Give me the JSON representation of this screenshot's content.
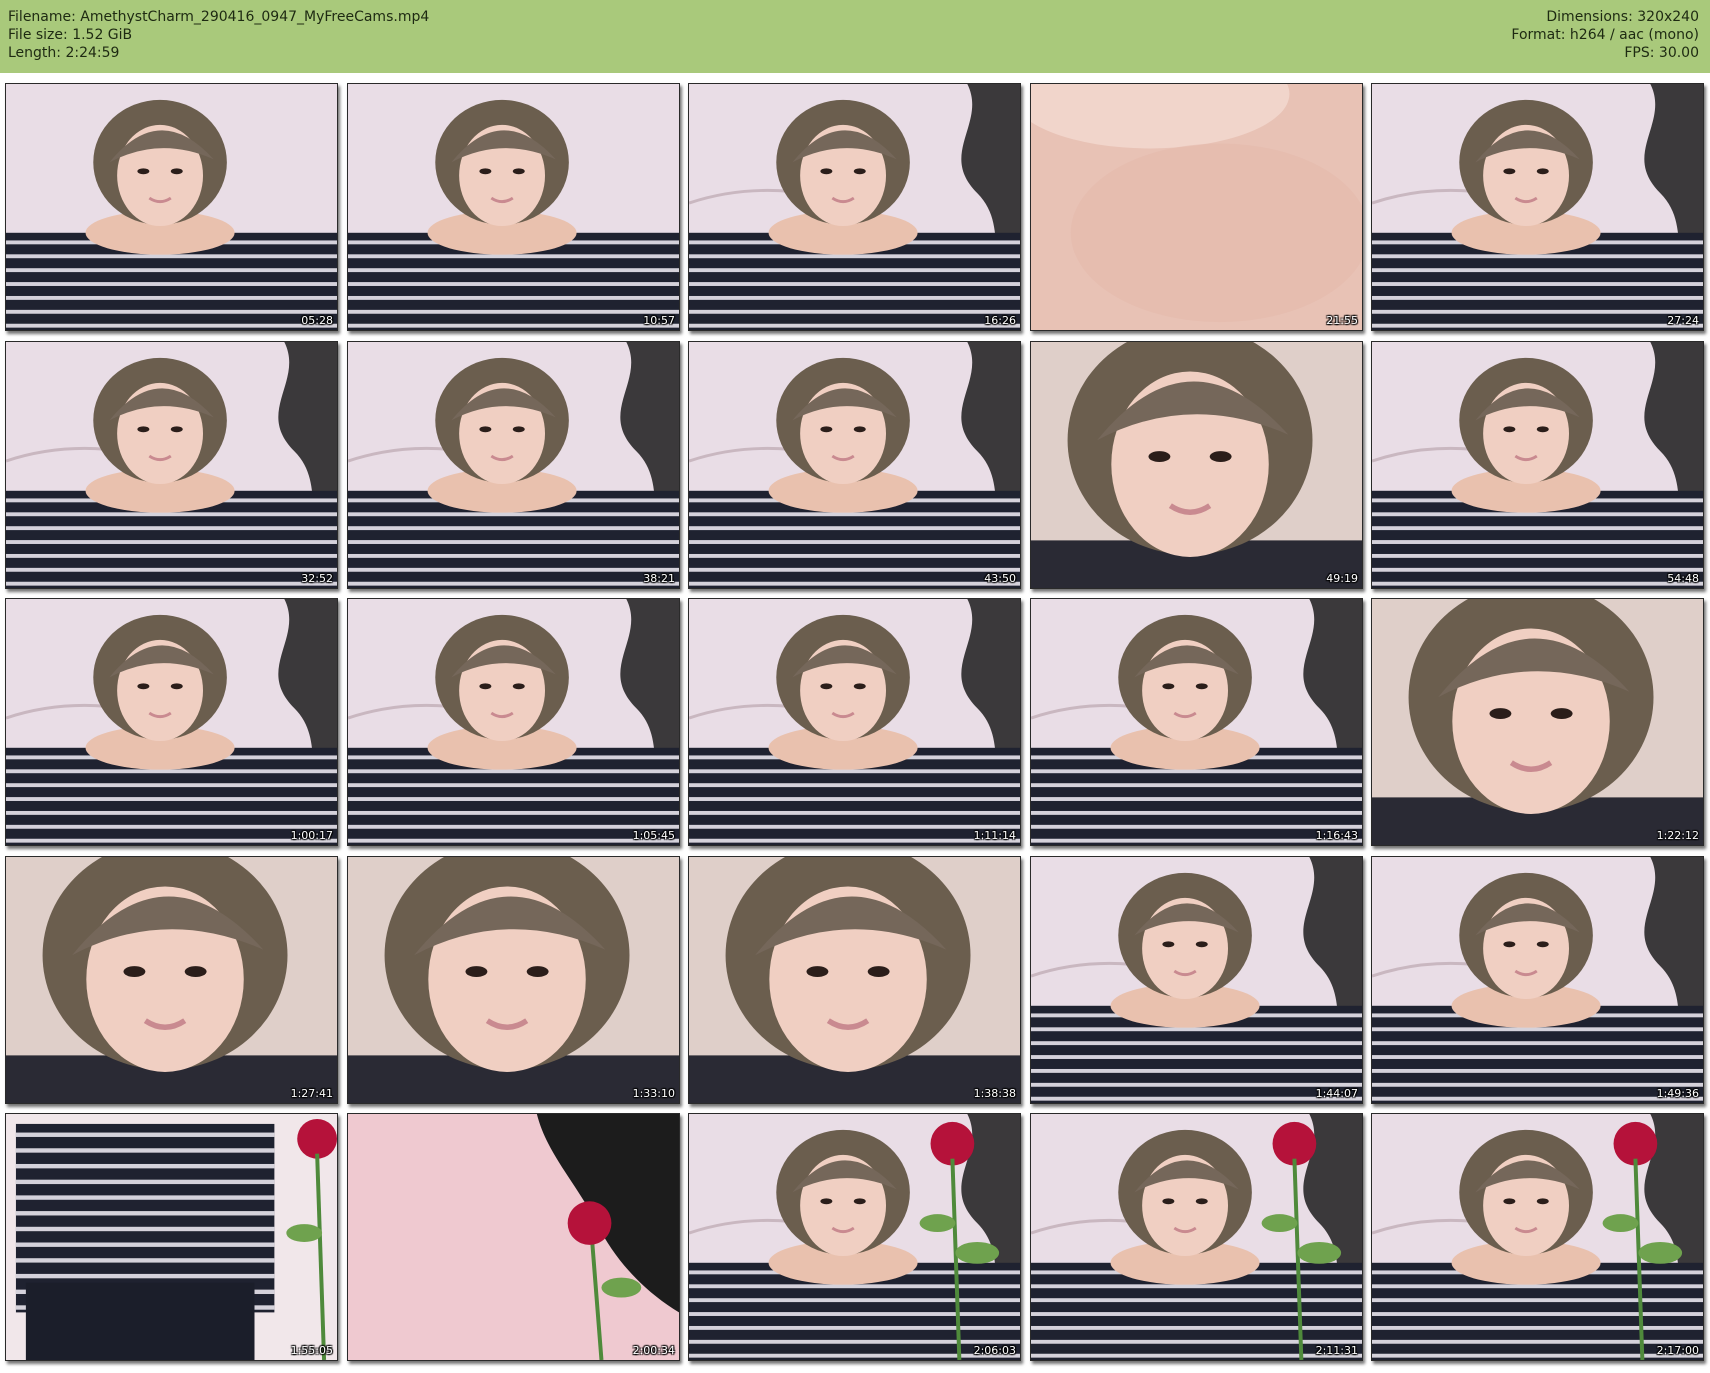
{
  "header": {
    "filename_label": "Filename: AmethystCharm_290416_0947_MyFreeCams.mp4",
    "filesize_label": "File size: 1.52 GiB",
    "length_label": "Length: 2:24:59",
    "dimensions_label": "Dimensions: 320x240",
    "format_label": "Format: h264 / aac (mono)",
    "fps_label": "FPS: 30.00"
  },
  "colors": {
    "header_background": "#a9c97b",
    "page_background": "#ffffff",
    "timecode_text": "#ffffff"
  },
  "thumbnails": [
    {
      "timecode": "05:28",
      "scene": "face-striped-shirt"
    },
    {
      "timecode": "10:57",
      "scene": "face-striped-shirt"
    },
    {
      "timecode": "16:26",
      "scene": "face-striped-shirt-wall"
    },
    {
      "timecode": "21:55",
      "scene": "skin-closeup"
    },
    {
      "timecode": "27:24",
      "scene": "face-striped-shirt-wall"
    },
    {
      "timecode": "32:52",
      "scene": "face-striped-shirt-wall"
    },
    {
      "timecode": "38:21",
      "scene": "face-striped-shirt-wall"
    },
    {
      "timecode": "43:50",
      "scene": "face-striped-shirt-wall"
    },
    {
      "timecode": "49:19",
      "scene": "face-closeup"
    },
    {
      "timecode": "54:48",
      "scene": "face-striped-shirt-wall"
    },
    {
      "timecode": "1:00:17",
      "scene": "face-striped-shirt-wall"
    },
    {
      "timecode": "1:05:45",
      "scene": "face-striped-shirt-wall"
    },
    {
      "timecode": "1:11:14",
      "scene": "face-striped-shirt-wall"
    },
    {
      "timecode": "1:16:43",
      "scene": "face-striped-shirt-wall"
    },
    {
      "timecode": "1:22:12",
      "scene": "face-closeup"
    },
    {
      "timecode": "1:27:41",
      "scene": "face-closeup"
    },
    {
      "timecode": "1:33:10",
      "scene": "face-closeup"
    },
    {
      "timecode": "1:38:38",
      "scene": "face-closeup"
    },
    {
      "timecode": "1:44:07",
      "scene": "face-striped-shirt-wall"
    },
    {
      "timecode": "1:49:36",
      "scene": "face-striped-shirt-wall"
    },
    {
      "timecode": "1:55:05",
      "scene": "torso-rose"
    },
    {
      "timecode": "2:00:34",
      "scene": "wall-rose"
    },
    {
      "timecode": "2:06:03",
      "scene": "face-rose"
    },
    {
      "timecode": "2:11:31",
      "scene": "face-rose"
    },
    {
      "timecode": "2:17:00",
      "scene": "face-rose"
    }
  ]
}
